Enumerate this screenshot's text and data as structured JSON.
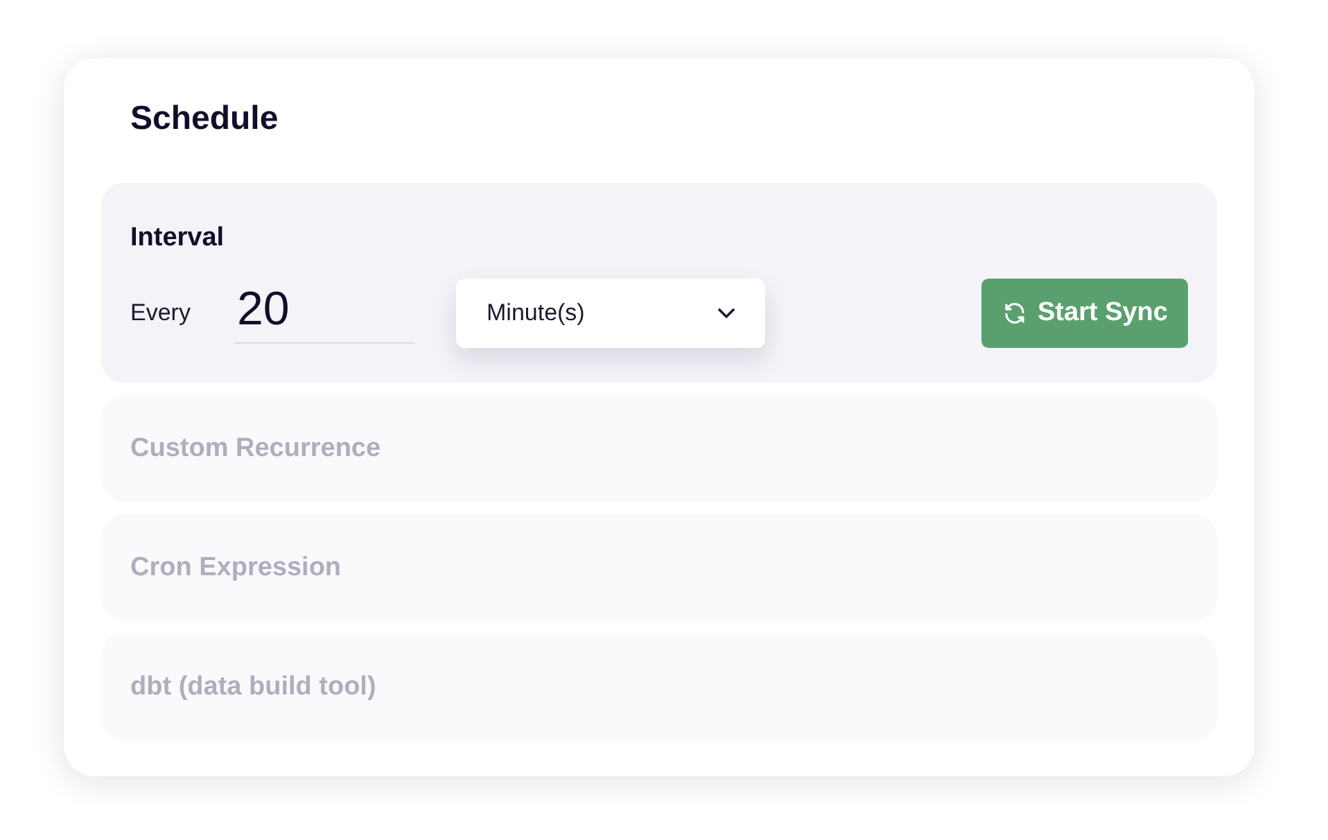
{
  "title": "Schedule",
  "options": [
    {
      "label": "Interval",
      "selected": true,
      "controls": {
        "every_label": "Every",
        "value": "20",
        "unit": "Minute(s)",
        "button": "Start Sync"
      }
    },
    {
      "label": "Custom Recurrence",
      "selected": false
    },
    {
      "label": "Cron Expression",
      "selected": false
    },
    {
      "label": "dbt (data build tool)",
      "selected": false
    }
  ]
}
